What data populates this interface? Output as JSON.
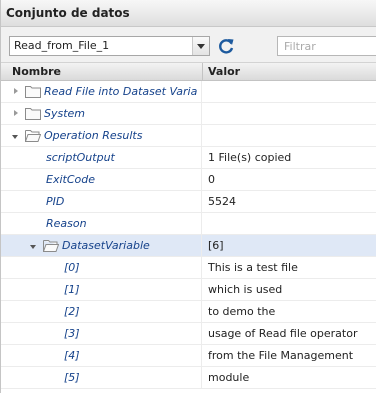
{
  "panel": {
    "title": "Conjunto de datos"
  },
  "toolbar": {
    "dataset_selected": "Read_from_File_1",
    "filter_placeholder": "Filtrar"
  },
  "columns": {
    "name": "Nombre",
    "value": "Valor"
  },
  "rows": [
    {
      "name": "Read File into Dataset Varia",
      "value": ""
    },
    {
      "name": "System",
      "value": ""
    },
    {
      "name": "Operation Results",
      "value": ""
    },
    {
      "name": "scriptOutput",
      "value": "1 File(s) copied"
    },
    {
      "name": "ExitCode",
      "value": "0"
    },
    {
      "name": "PID",
      "value": "5524"
    },
    {
      "name": "Reason",
      "value": ""
    },
    {
      "name": "DatasetVariable",
      "value": "[6]"
    },
    {
      "name": "[0]",
      "value": "This is a test file"
    },
    {
      "name": "[1]",
      "value": "which is used"
    },
    {
      "name": "[2]",
      "value": "to demo the"
    },
    {
      "name": "[3]",
      "value": "usage of Read file operator"
    },
    {
      "name": "[4]",
      "value": "from the File Management"
    },
    {
      "name": "[5]",
      "value": "module"
    }
  ]
}
